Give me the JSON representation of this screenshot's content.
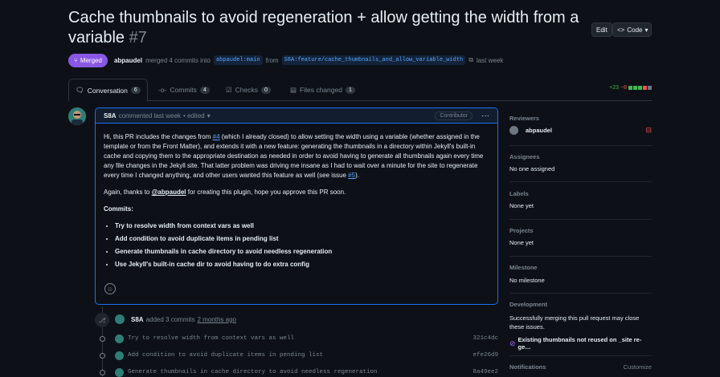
{
  "pr": {
    "title": "Cache thumbnails to avoid regeneration + allow getting the width from a variable",
    "number": "#7",
    "edit_label": "Edit",
    "code_label": "Code",
    "status": "Merged",
    "author": "abpaudel",
    "merged_text": "merged 4 commits into",
    "base_branch": "abpaudel:main",
    "from_text": "from",
    "head_branch": "S8A:feature/cache_thumbnails_and_allow_variable_width",
    "time": "last week"
  },
  "tabs": [
    {
      "label": "Conversation",
      "count": "6"
    },
    {
      "label": "Commits",
      "count": "4"
    },
    {
      "label": "Checks",
      "count": "0"
    },
    {
      "label": "Files changed",
      "count": "1"
    }
  ],
  "diffstat": {
    "add": "+23",
    "del": "−8"
  },
  "comment": {
    "author": "S8A",
    "meta": "commented last week",
    "edited": "• edited",
    "badge": "Contributor",
    "p1_a": "Hi, this PR includes the changes from ",
    "p1_link1": "#4",
    "p1_b": " (which I already closed) to allow setting the width using a variable (whether assigned in the template or from the Front Matter), and extends it with a new feature: generating the thumbnails in a directory within Jekyll's built-in cache and copying them to the appropriate destination as needed in order to avoid having to generate all thumbnails again every time any file changes in the Jekyll site. That latter problem was driving me insane as I had to wait over a minute for the site to regenerate every time I changed anything, and other users wanted this feature as well (see issue ",
    "p1_link2": "#5",
    "p1_c": ").",
    "p2_a": "Again, thanks to ",
    "p2_mention": "@abpaudel",
    "p2_b": " for creating this plugin, hope you approve this PR soon.",
    "commits_heading": "Commits:",
    "commits": [
      "Try to resolve width from context vars as well",
      "Add condition to avoid duplicate items in pending list",
      "Generate thumbnails in cache directory to avoid needless regeneration",
      "Use Jekyll's built-in cache dir to avoid having to do extra config"
    ]
  },
  "event": {
    "author": "S8A",
    "text": "added 3 commits",
    "time": "2 months ago"
  },
  "commit_list": [
    {
      "msg": "Try to resolve width from context vars as well",
      "sha": "321c4dc"
    },
    {
      "msg": "Add condition to avoid duplicate items in pending list",
      "sha": "efe26d9"
    },
    {
      "msg": "Generate thumbnails in cache directory to avoid needless regeneration",
      "sha": "8a49ee2"
    }
  ],
  "sidebar": {
    "reviewers_title": "Reviewers",
    "reviewer": "abpaudel",
    "assignees_title": "Assignees",
    "assignees_value": "No one assigned",
    "labels_title": "Labels",
    "labels_value": "None yet",
    "projects_title": "Projects",
    "projects_value": "None yet",
    "milestone_title": "Milestone",
    "milestone_value": "No milestone",
    "development_title": "Development",
    "development_text": "Successfully merging this pull request may close these issues.",
    "linked_issue": "Existing thumbnails not reused on _site re-ge…",
    "notifications_title": "Notifications",
    "customize": "Customize"
  }
}
